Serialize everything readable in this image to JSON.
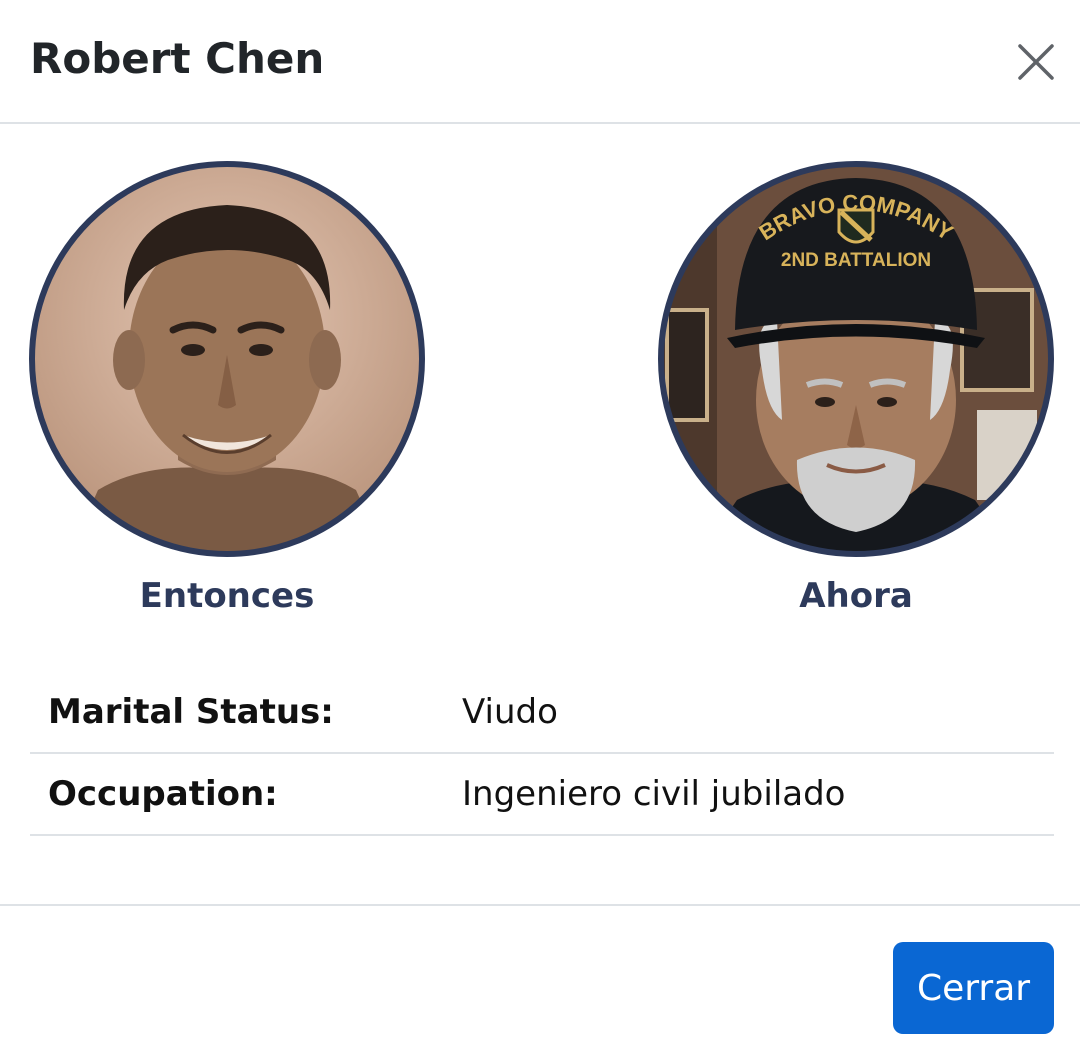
{
  "modal": {
    "title": "Robert Chen",
    "close_icon": "close-icon"
  },
  "photos": {
    "then_label": "Entonces",
    "now_label": "Ahora",
    "now_cap_line1": "BRAVO COMPANY",
    "now_cap_line2": "2ND BATTALION"
  },
  "details": [
    {
      "label": "Marital Status:",
      "value": "Viudo"
    },
    {
      "label": "Occupation:",
      "value": "Ingeniero civil jubilado"
    }
  ],
  "footer": {
    "close_button_label": "Cerrar"
  },
  "colors": {
    "primary_button": "#0a67d3",
    "caption_text": "#2d3a5b",
    "avatar_border": "#2d3a5b",
    "divider": "#dee2e6"
  }
}
